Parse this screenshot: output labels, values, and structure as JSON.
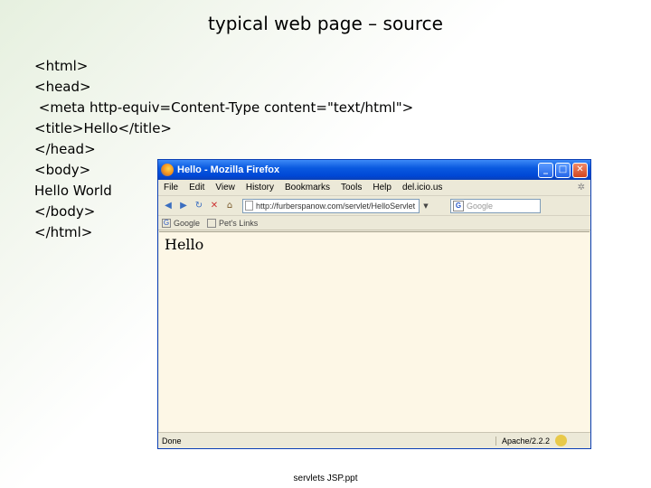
{
  "slide": {
    "title": "typical web page – source",
    "footer": "servlets JSP.ppt"
  },
  "source_lines": [
    "<html>",
    "<head>",
    " <meta http-equiv=Content-Type content=\"text/html\">",
    "<title>Hello</title>",
    "</head>",
    "<body>",
    "Hello World",
    "</body>",
    "</html>"
  ],
  "browser": {
    "window_title": "Hello - Mozilla Firefox",
    "menu": [
      "File",
      "Edit",
      "View",
      "History",
      "Bookmarks",
      "Tools",
      "Help",
      "del.icio.us"
    ],
    "url": "http://furberspanow.com/servlet/HelloServlet",
    "search_placeholder": "Google",
    "bookmarks": [
      "Google",
      "Pet's Links"
    ],
    "page_content": "Hello",
    "status_text": "Done",
    "server_text": "Apache/2.2.2"
  }
}
